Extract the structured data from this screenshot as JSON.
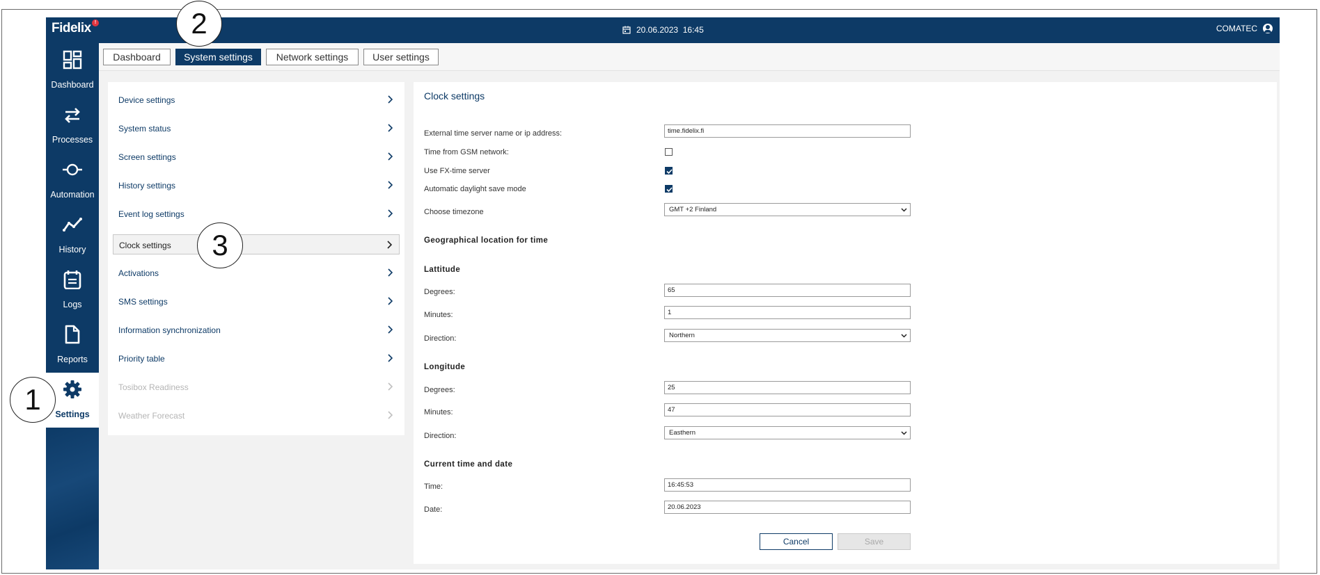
{
  "app": {
    "logo": "Fidelix",
    "alert_badge": "!",
    "datetime": "20.06.2023  16:45",
    "user": "COMATEC"
  },
  "sidebar": {
    "items": [
      {
        "label": "Dashboard",
        "icon": "dashboard-icon"
      },
      {
        "label": "Processes",
        "icon": "processes-icon"
      },
      {
        "label": "Automation",
        "icon": "automation-icon"
      },
      {
        "label": "History",
        "icon": "history-icon"
      },
      {
        "label": "Logs",
        "icon": "logs-icon"
      },
      {
        "label": "Reports",
        "icon": "reports-icon"
      },
      {
        "label": "Settings",
        "icon": "gear-icon",
        "active": true
      }
    ]
  },
  "tabs": [
    {
      "label": "Dashboard"
    },
    {
      "label": "System settings",
      "active": true
    },
    {
      "label": "Network settings"
    },
    {
      "label": "User settings"
    }
  ],
  "menu": {
    "items": [
      {
        "label": "Device settings"
      },
      {
        "label": "System status"
      },
      {
        "label": "Screen settings"
      },
      {
        "label": "History settings"
      },
      {
        "label": "Event log settings"
      },
      {
        "label": "Clock settings",
        "active": true
      },
      {
        "label": "Activations"
      },
      {
        "label": "SMS settings"
      },
      {
        "label": "Information synchronization"
      },
      {
        "label": "Priority table"
      },
      {
        "label": "Tosibox Readiness",
        "disabled": true
      },
      {
        "label": "Weather Forecast",
        "disabled": true
      }
    ]
  },
  "clock": {
    "title": "Clock settings",
    "time_server_label": "External time server name or ip address:",
    "time_server_value": "time.fidelix.fi",
    "gsm_label": "Time from GSM network:",
    "gsm_checked": false,
    "fx_label": "Use FX-time server",
    "fx_checked": true,
    "dst_label": "Automatic daylight save mode",
    "dst_checked": true,
    "timezone_label": "Choose timezone",
    "timezone_value": "GMT +2 Finland",
    "geo_heading": "Geographical location for time",
    "lat_heading": "Lattitude",
    "lat_degrees_label": "Degrees:",
    "lat_degrees_value": "65",
    "lat_minutes_label": "Minutes:",
    "lat_minutes_value": "1",
    "lat_direction_label": "Direction:",
    "lat_direction_value": "Northern",
    "lon_heading": "Longitude",
    "lon_degrees_label": "Degrees:",
    "lon_degrees_value": "25",
    "lon_minutes_label": "Minutes:",
    "lon_minutes_value": "47",
    "lon_direction_label": "Direction:",
    "lon_direction_value": "Easthern",
    "current_heading": "Current time and date",
    "time_label": "Time:",
    "time_value": "16:45:53",
    "date_label": "Date:",
    "date_value": "20.06.2023",
    "cancel_label": "Cancel",
    "save_label": "Save"
  },
  "callouts": {
    "one": "1",
    "two": "2",
    "three": "3"
  },
  "colors": {
    "brand": "#0d3a66",
    "alert": "#e0353f"
  }
}
